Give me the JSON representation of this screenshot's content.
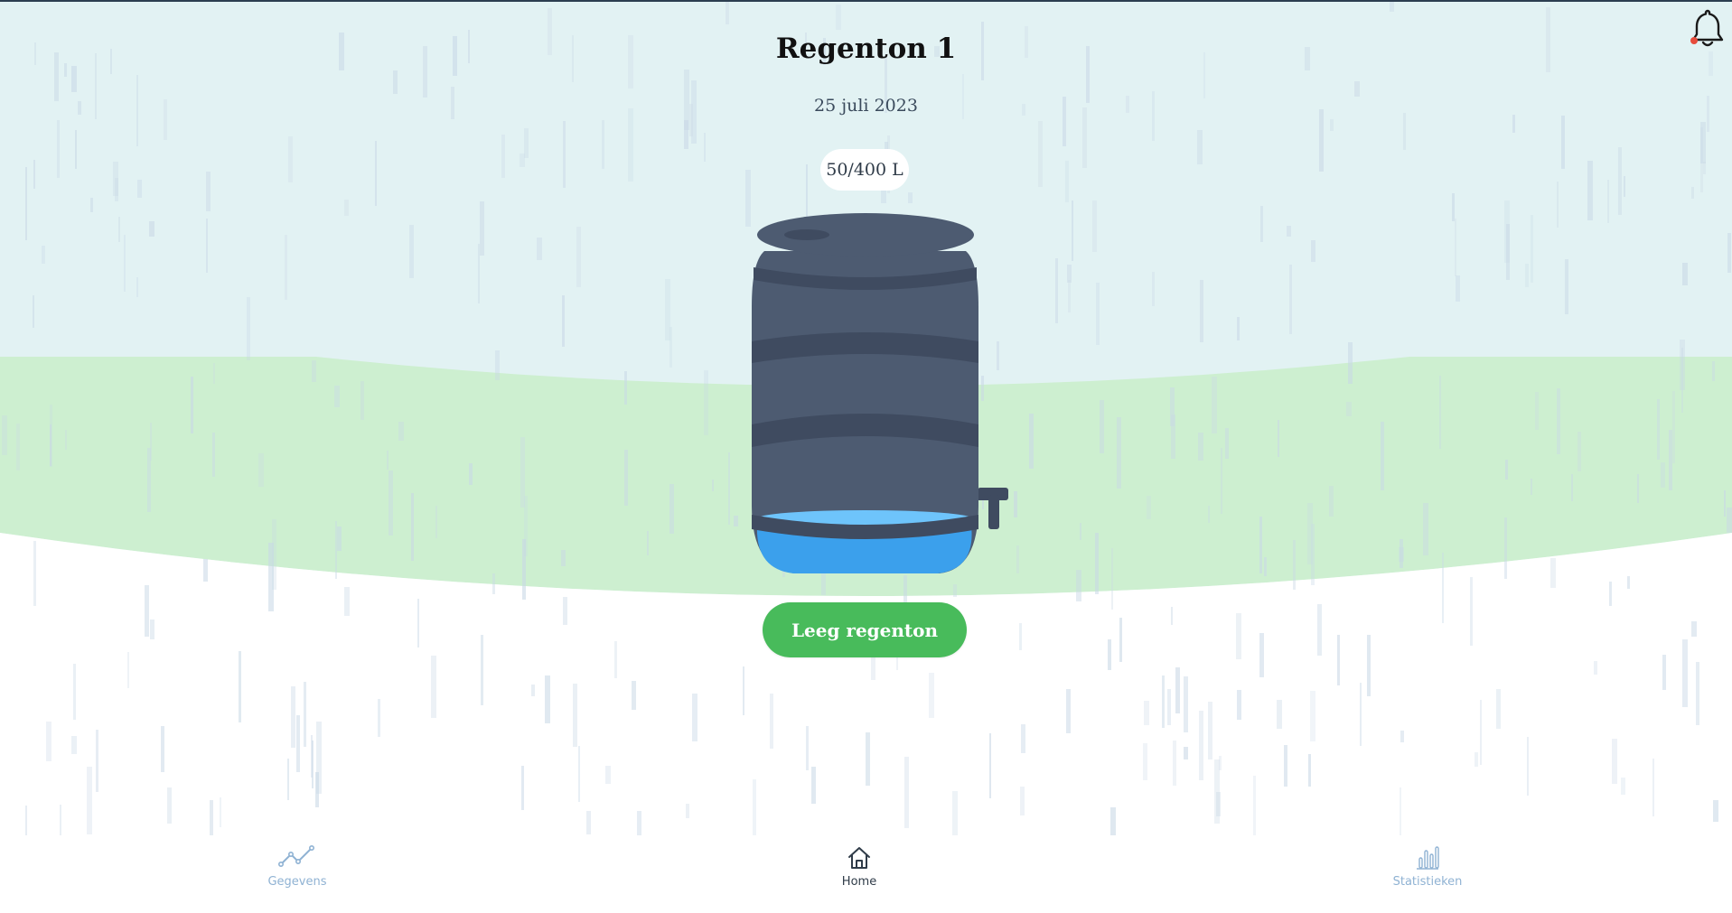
{
  "header": {
    "title": "Regenton 1",
    "date": "25 juli 2023"
  },
  "tank": {
    "level_text": "50/400 L",
    "current_liters": 50,
    "capacity_liters": 400,
    "fill_fraction": 0.125
  },
  "actions": {
    "empty_label": "Leeg regenton"
  },
  "notifications": {
    "has_unread": true
  },
  "nav": {
    "items": [
      {
        "label": "Gegevens",
        "icon": "line-chart-icon",
        "active": false
      },
      {
        "label": "Home",
        "icon": "home-icon",
        "active": true
      },
      {
        "label": "Statistieken",
        "icon": "bar-chart-icon",
        "active": false
      }
    ]
  },
  "colors": {
    "sky": "#e2f2f3",
    "grass": "#cdefd0",
    "barrel": "#4d5b71",
    "barrel_dark": "#3f4b60",
    "water": "#3ba0ec",
    "water_light": "#6ec4fb",
    "button": "#48bb5b",
    "notification_dot": "#e74c3c",
    "nav_inactive": "#8fb2d3",
    "nav_active": "#2f3b48"
  }
}
